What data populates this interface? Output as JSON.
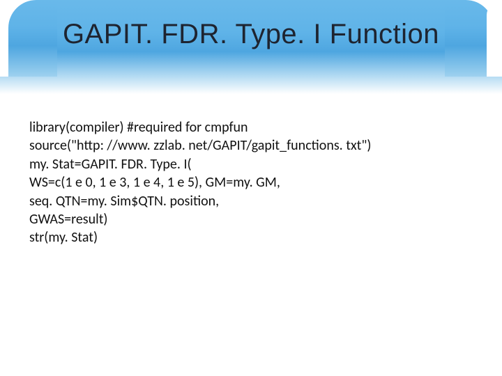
{
  "title": "GAPIT. FDR. Type. I Function",
  "code": {
    "l1": "library(compiler) #required for cmpfun",
    "l2": "source(\"http: //www. zzlab. net/GAPIT/gapit_functions. txt\")",
    "l3": "my. Stat=GAPIT. FDR. Type. I(",
    "l4": "WS=c(1 e 0, 1 e 3, 1 e 4, 1 e 5), GM=my. GM,",
    "l5": "seq. QTN=my. Sim$QTN. position,",
    "l6": "GWAS=result)",
    "l7": "str(my. Stat)"
  }
}
